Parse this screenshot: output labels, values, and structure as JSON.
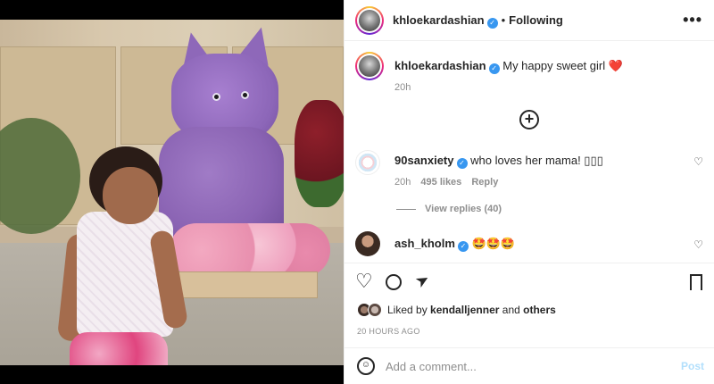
{
  "post": {
    "author": "khloekardashian",
    "follow_status": "Following",
    "more_label": "•••",
    "caption_text": "My happy sweet girl",
    "caption_emoji": "❤️",
    "caption_time": "20h",
    "load_more_icon": "⊕"
  },
  "comments": [
    {
      "user": "90sanxiety",
      "text": "who loves her mama! ▯▯▯",
      "time": "20h",
      "likes": "495 likes",
      "reply_label": "Reply",
      "view_replies": "View replies (40)"
    },
    {
      "user": "ash_kholm",
      "text": "🤩🤩🤩"
    }
  ],
  "actions": {
    "like_icon": "♡",
    "comment_icon": "○",
    "share_icon": "➤",
    "save_icon": "▭"
  },
  "likes": {
    "prefix": "Liked by",
    "user": "kendalljenner",
    "and": "and",
    "others": "others"
  },
  "timestamp": "20 HOURS AGO",
  "add_comment": {
    "placeholder": "Add a comment...",
    "post_label": "Post",
    "emoji_icon": "☺"
  },
  "colors": {
    "accent": "#3897f0",
    "post_disabled": "#b2dffc",
    "muted": "#8e8e8e",
    "text": "#262626"
  }
}
